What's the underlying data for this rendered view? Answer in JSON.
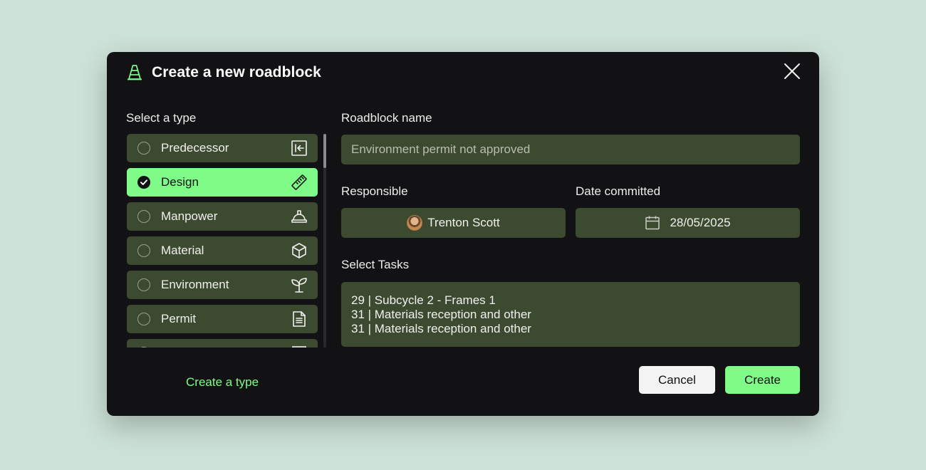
{
  "dialog": {
    "title": "Create a new roadblock",
    "title_icon": "traffic-cone-icon",
    "close_icon": "close-icon"
  },
  "type_section": {
    "label": "Select a type",
    "items": [
      {
        "label": "Predecessor",
        "icon": "arrow-left-bar-icon",
        "selected": false
      },
      {
        "label": "Design",
        "icon": "ruler-icon",
        "selected": true
      },
      {
        "label": "Manpower",
        "icon": "hard-hat-icon",
        "selected": false
      },
      {
        "label": "Material",
        "icon": "cube-icon",
        "selected": false
      },
      {
        "label": "Environment",
        "icon": "sprout-icon",
        "selected": false
      },
      {
        "label": "Permit",
        "icon": "document-icon",
        "selected": false
      }
    ],
    "create_link": "Create a type"
  },
  "form": {
    "name_label": "Roadblock name",
    "name_value": "Environment permit not approved",
    "responsible_label": "Responsible",
    "responsible_value": "Trenton Scott",
    "date_label": "Date committed",
    "date_value": "28/05/2025",
    "tasks_label": "Select Tasks",
    "tasks": [
      "29 | Subcycle 2 - Frames 1",
      "31 | Materials reception and other",
      "31 | Materials reception and other"
    ]
  },
  "actions": {
    "cancel_label": "Cancel",
    "create_label": "Create"
  },
  "colors": {
    "accent": "#7ffc87",
    "panel": "#121214",
    "field": "#3c4a2f",
    "background": "#cde2d8"
  }
}
